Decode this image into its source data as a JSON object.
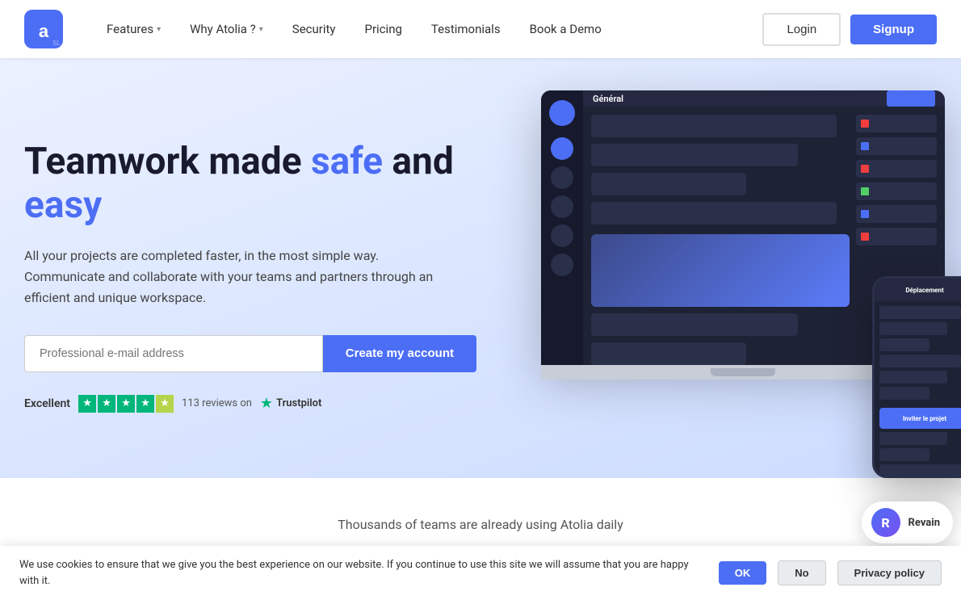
{
  "nav": {
    "logo_alt": "Atolia - a SaaS Labs company",
    "links": [
      {
        "id": "features",
        "label": "Features",
        "has_dropdown": true
      },
      {
        "id": "why-atolia",
        "label": "Why Atolia ?",
        "has_dropdown": true
      },
      {
        "id": "security",
        "label": "Security",
        "has_dropdown": false
      },
      {
        "id": "pricing",
        "label": "Pricing",
        "has_dropdown": false
      },
      {
        "id": "testimonials",
        "label": "Testimonials",
        "has_dropdown": false
      },
      {
        "id": "book-demo",
        "label": "Book a Demo",
        "has_dropdown": false
      }
    ],
    "login_label": "Login",
    "signup_label": "Signup"
  },
  "hero": {
    "title_start": "Teamwork made ",
    "title_highlight1": "safe",
    "title_middle": " and ",
    "title_highlight2": "easy",
    "description": "All your projects are completed faster, in the most simple way. Communicate and collaborate with your teams and partners through an efficient and unique workspace.",
    "input_placeholder": "Professional e-mail address",
    "cta_label": "Create my account"
  },
  "trustpilot": {
    "rating_label": "Excellent",
    "review_count": "113",
    "review_text": "reviews on",
    "platform": "Trustpilot"
  },
  "cookie": {
    "message": "We use cookies to ensure that we give you the best experience on our website. If you continue to use this site we will assume that you are happy with it.",
    "ok_label": "OK",
    "no_label": "No",
    "privacy_label": "Privacy policy"
  },
  "revain": {
    "label": "Revain"
  },
  "bottom_section": {
    "text": "Thousands of teams are already using Atolia daily"
  }
}
